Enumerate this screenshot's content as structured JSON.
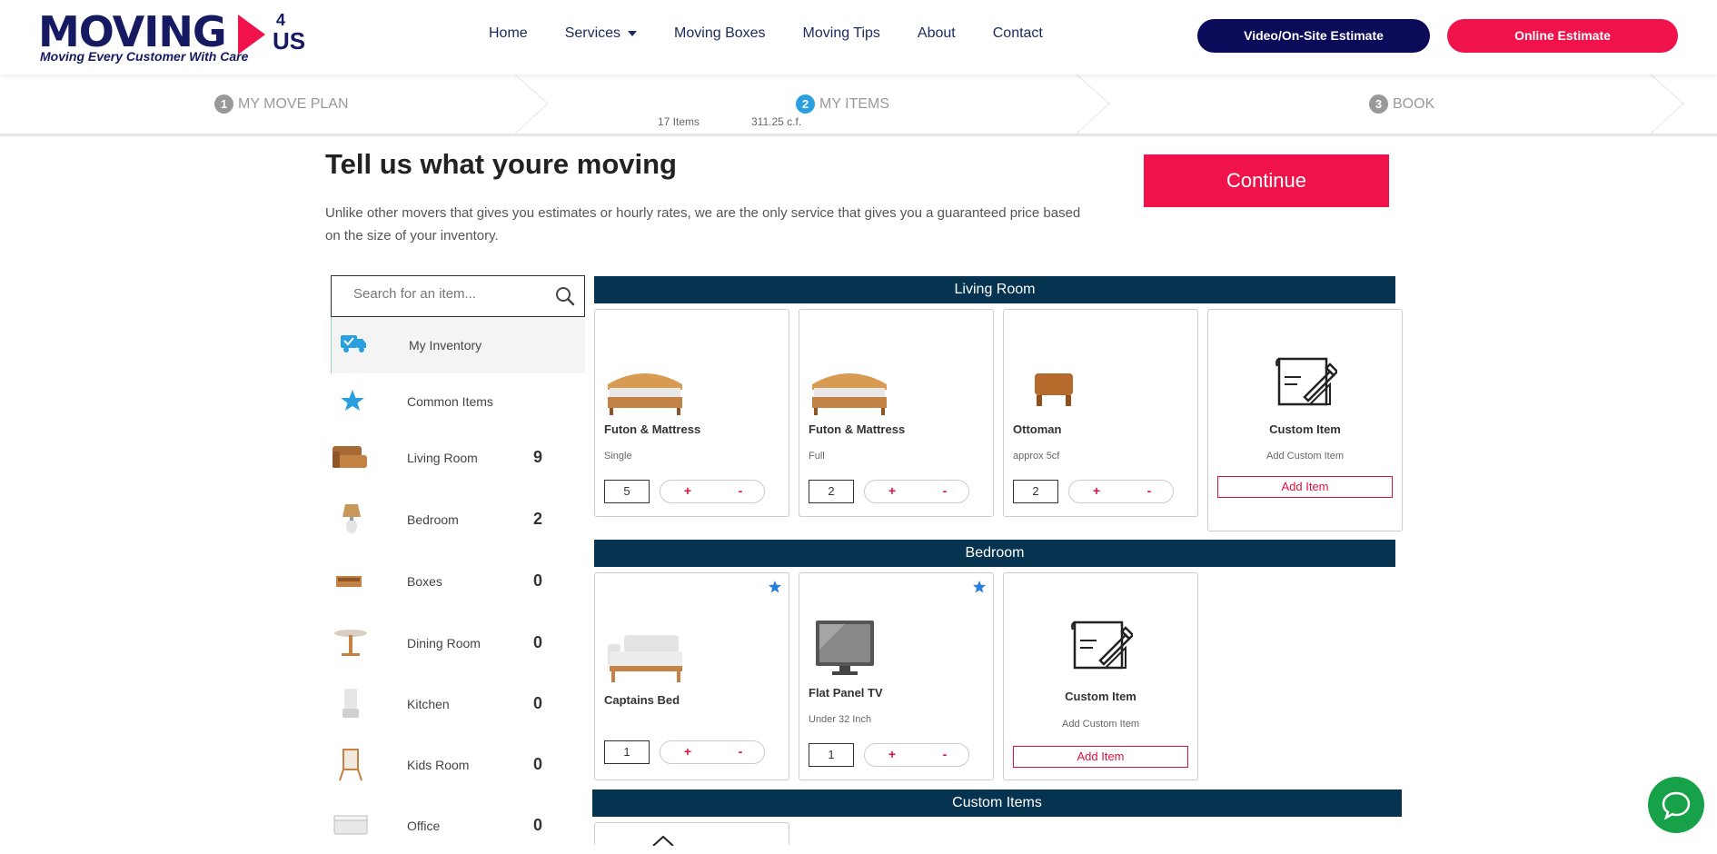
{
  "brand": {
    "word": "MOVING",
    "four": "4",
    "us": "US",
    "tagline": "Moving Every Customer With Care"
  },
  "nav": {
    "items": [
      "Home",
      "Services",
      "Moving Boxes",
      "Moving Tips",
      "About",
      "Contact"
    ]
  },
  "header_buttons": {
    "video": "Video/On-Site Estimate",
    "online": "Online Estimate"
  },
  "steps": [
    {
      "num": "1",
      "label": "MY MOVE PLAN"
    },
    {
      "num": "2",
      "label": "MY ITEMS"
    },
    {
      "num": "3",
      "label": "BOOK"
    }
  ],
  "summary": {
    "items": "17 Items",
    "volume": "311.25 c.f."
  },
  "page": {
    "title": "Tell us what youre moving",
    "intro": "Unlike other movers that gives you estimates or hourly rates, we are the only service that gives you a guaranteed price based on the size of your inventory.",
    "continue": "Continue"
  },
  "search": {
    "placeholder": "Search for an item..."
  },
  "categories": [
    {
      "label": "My Inventory",
      "count": "",
      "icon": "truck-icon"
    },
    {
      "label": "Common Items",
      "count": "",
      "icon": "star-icon"
    },
    {
      "label": "Living Room",
      "count": "9",
      "icon": "armchair-icon"
    },
    {
      "label": "Bedroom",
      "count": "2",
      "icon": "lamp-icon"
    },
    {
      "label": "Boxes",
      "count": "0",
      "icon": "box-icon"
    },
    {
      "label": "Dining Room",
      "count": "0",
      "icon": "table-icon"
    },
    {
      "label": "Kitchen",
      "count": "0",
      "icon": "blender-icon"
    },
    {
      "label": "Kids Room",
      "count": "0",
      "icon": "easel-icon"
    },
    {
      "label": "Office",
      "count": "0",
      "icon": "filebox-icon"
    }
  ],
  "sections": {
    "living": "Living Room",
    "bedroom": "Bedroom",
    "custom": "Custom Items"
  },
  "living_items": [
    {
      "name": "Futon & Mattress",
      "sub": "Single",
      "qty": "5"
    },
    {
      "name": "Futon & Mattress",
      "sub": "Full",
      "qty": "2"
    },
    {
      "name": "Ottoman",
      "sub": "approx 5cf",
      "qty": "2"
    }
  ],
  "bedroom_items": [
    {
      "name": "Captains Bed",
      "sub": "",
      "qty": "1"
    },
    {
      "name": "Flat Panel TV",
      "sub": "Under 32 Inch",
      "qty": "1"
    }
  ],
  "custom_card": {
    "name": "Custom Item",
    "sub": "Add Custom Item",
    "button": "Add Item"
  },
  "stepper": {
    "plus": "+",
    "minus": "-"
  },
  "colors": {
    "brand_navy": "#151a63",
    "accent_red": "#f0124b",
    "section_header": "#053350",
    "active_step": "#2aa0e0",
    "chat_green": "#17a24a"
  }
}
